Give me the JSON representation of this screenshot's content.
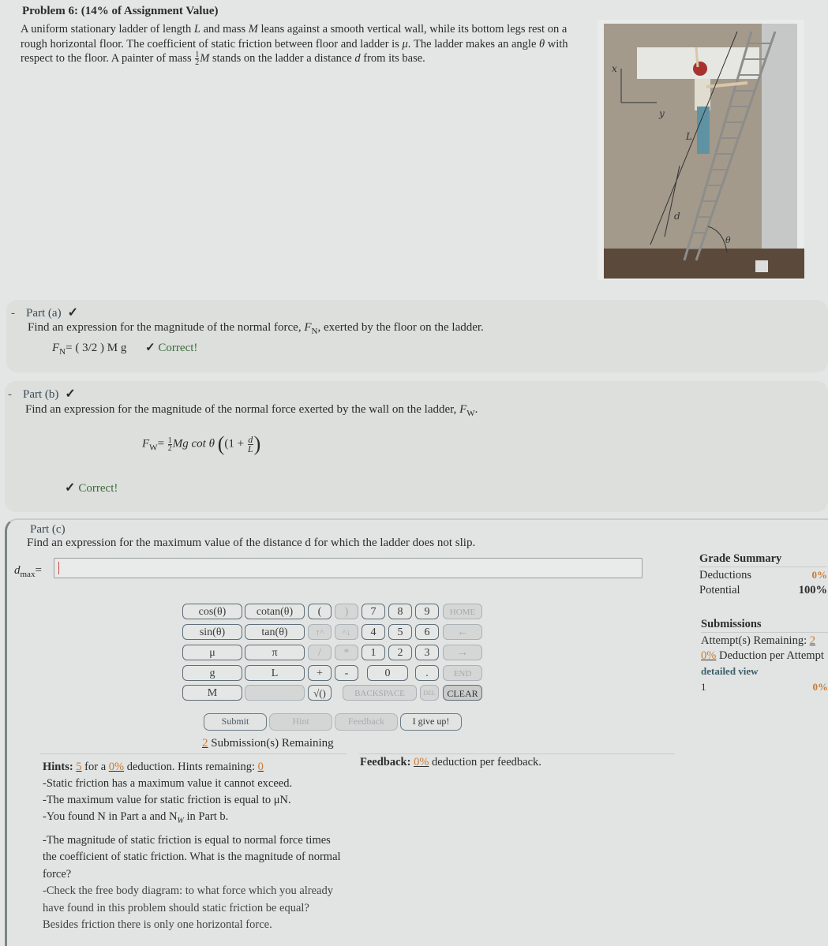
{
  "problem": {
    "title": "Problem 6: (14% of Assignment Value)",
    "text_1": "A uniform stationary ladder of length ",
    "L": "L",
    "text_2": " and mass ",
    "M": "M",
    "text_3": " leans against a smooth vertical wall, while its bottom legs rest on a rough horizontal floor. The coefficient of static friction between floor and ladder is ",
    "mu": "μ",
    "text_4": ". The ladder makes an angle ",
    "theta": "θ",
    "text_5": " with respect to the floor. A painter of mass ",
    "frac_num": "1",
    "frac_den": "2",
    "text_6": " stands on the ladder a distance ",
    "d": "d",
    "text_7": " from its base."
  },
  "figure": {
    "axis_x": "x",
    "axis_y": "y",
    "label_L": "L",
    "label_d": "d",
    "label_theta": "θ"
  },
  "part_a": {
    "collapse": "-",
    "label": "Part (a)",
    "check": "✓",
    "question_1": "Find an expression for the magnitude of the normal force, ",
    "force": "F",
    "sub": "N",
    "question_2": ", exerted by the floor on the ladder.",
    "answer": "= ( 3/2 ) M g",
    "status": "Correct!"
  },
  "part_b": {
    "collapse": "-",
    "label": "Part (b)",
    "check": "✓",
    "question": "Find an expression for the magnitude of the normal force exerted by the wall on the ladder, ",
    "force": "F",
    "sub": "W",
    "answer_eq": "= ",
    "answer_frac_num": "1",
    "answer_frac_den": "2",
    "answer_body": "Mg cot θ",
    "answer_paren": "(1 + ",
    "answer_d": "d",
    "answer_L": "L",
    "answer_close": ")",
    "status": "Correct!"
  },
  "part_c": {
    "label": "Part (c)",
    "question": "Find an expression for the maximum value of the distance d for which the ladder does not slip.",
    "input_label": "d",
    "input_sub": "max",
    "input_eq": "=",
    "input_value": ""
  },
  "keypad": {
    "vars": [
      "cos(θ)",
      "cotan(θ)",
      "sin(θ)",
      "tan(θ)",
      "μ",
      "π",
      "g",
      "L",
      "M",
      ""
    ],
    "ops": [
      "(",
      ")",
      "↑^",
      "^↓",
      "/",
      "*",
      "+",
      "-",
      "√()"
    ],
    "digits": [
      "7",
      "8",
      "9",
      "4",
      "5",
      "6",
      "1",
      "2",
      "3",
      "0",
      "."
    ],
    "nav": [
      "HOME",
      "←",
      "→",
      "END"
    ],
    "backspace": "BACKSPACE",
    "del": "DEL",
    "clear": "CLEAR"
  },
  "actions": {
    "submit": "Submit",
    "hint": "Hint",
    "feedback": "Feedback",
    "give_up": "I give up!"
  },
  "submissions": {
    "count": "2",
    "label": " Submission(s) Remaining"
  },
  "hints": {
    "label": "Hints:",
    "count": "5",
    "for_a": " for a ",
    "deduction": "0%",
    "deduction_text": " deduction. Hints remaining: ",
    "remaining": "0",
    "items": [
      "-Static friction has a maximum value it cannot exceed.",
      "-The maximum value for static friction is equal to μN.",
      "-You found N in Part a and N",
      "-The magnitude of static friction is equal to normal force times the coefficient of static friction. What is the magnitude of normal force?",
      "-Check the free body diagram: to what force which you already have found in this problem should static friction be equal? Besides friction there is only one horizontal force."
    ],
    "item3_sub": "W",
    "item3_tail": " in Part b."
  },
  "feedback": {
    "label": "Feedback:",
    "value": "0%",
    "text": " deduction per feedback."
  },
  "grade_summary": {
    "title": "Grade Summary",
    "deductions_label": "Deductions",
    "deductions_value": "0%",
    "potential_label": "Potential",
    "potential_value": "100%"
  },
  "submission_summary": {
    "title": "Submissions",
    "attempts_label": "Attempt(s) Remaining: ",
    "attempts_value": "2",
    "deduction_value": "0%",
    "deduction_label": " Deduction per Attempt",
    "detailed_view": "detailed view",
    "row_index": "1",
    "row_value": "0%"
  },
  "colors": {
    "accent_orange": "#c97a35",
    "correct_green": "#3b6b3b",
    "link_blue": "#3d5f6e"
  }
}
